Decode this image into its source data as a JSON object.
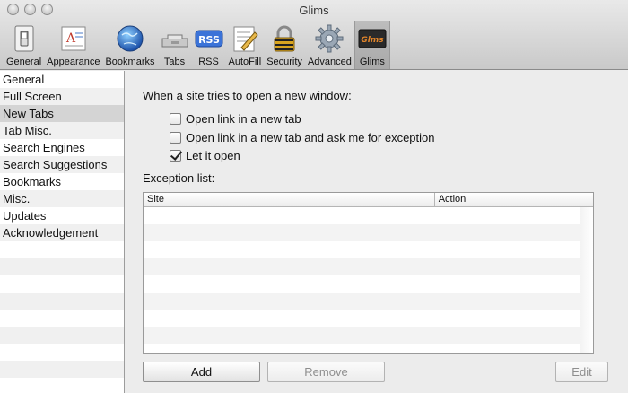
{
  "window": {
    "title": "Glims"
  },
  "toolbar": {
    "items": [
      {
        "label": "General",
        "icon": "light-switch-icon"
      },
      {
        "label": "Appearance",
        "icon": "font-document-icon"
      },
      {
        "label": "Bookmarks",
        "icon": "globe-icon"
      },
      {
        "label": "Tabs",
        "icon": "tab-icon"
      },
      {
        "label": "RSS",
        "icon": "rss-icon",
        "icon_text": "RSS"
      },
      {
        "label": "AutoFill",
        "icon": "pencil-form-icon"
      },
      {
        "label": "Security",
        "icon": "padlock-icon"
      },
      {
        "label": "Advanced",
        "icon": "gear-icon"
      },
      {
        "label": "Glims",
        "icon": "glims-icon",
        "icon_text": "Glms"
      }
    ],
    "active": "Glims"
  },
  "sidebar": {
    "items": [
      {
        "label": "General"
      },
      {
        "label": "Full Screen"
      },
      {
        "label": "New Tabs",
        "selected": true
      },
      {
        "label": "Tab Misc."
      },
      {
        "label": "Search Engines"
      },
      {
        "label": "Search Suggestions"
      },
      {
        "label": "Bookmarks"
      },
      {
        "label": "Misc."
      },
      {
        "label": "Updates"
      },
      {
        "label": "Acknowledgement"
      }
    ]
  },
  "main": {
    "question": "When a site tries to open a new window:",
    "options": [
      {
        "label": "Open link in a new tab",
        "checked": false
      },
      {
        "label": "Open link in a new tab and ask me for exception",
        "checked": false
      },
      {
        "label": "Let it open",
        "checked": true
      }
    ],
    "exception_label": "Exception list:",
    "table": {
      "columns": [
        "Site",
        "Action"
      ],
      "rows": []
    },
    "buttons": {
      "add": "Add",
      "remove": "Remove",
      "edit": "Edit"
    }
  },
  "colors": {
    "selected_row": "#d4d4d4",
    "stripe": "#f0f0f0",
    "rss_blue": "#3b73d8"
  }
}
